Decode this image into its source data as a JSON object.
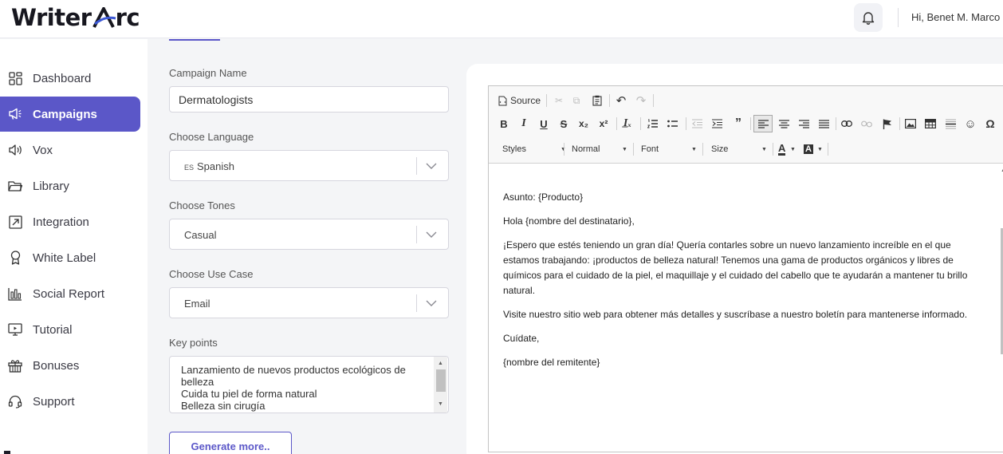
{
  "header": {
    "logo_prefix": "Writer",
    "logo_suffix": "rc",
    "greeting": "Hi, Benet M. Marco"
  },
  "sidebar": {
    "items": [
      {
        "label": "Dashboard",
        "icon": "dashboard-icon"
      },
      {
        "label": "Campaigns",
        "icon": "megaphone-icon",
        "active": true
      },
      {
        "label": "Vox",
        "icon": "speaker-icon"
      },
      {
        "label": "Library",
        "icon": "folder-icon"
      },
      {
        "label": "Integration",
        "icon": "integration-arrow-icon"
      },
      {
        "label": "White Label",
        "icon": "award-icon"
      },
      {
        "label": "Social Report",
        "icon": "bar-chart-icon"
      },
      {
        "label": "Tutorial",
        "icon": "monitor-icon"
      },
      {
        "label": "Bonuses",
        "icon": "gift-icon"
      },
      {
        "label": "Support",
        "icon": "headset-icon"
      }
    ]
  },
  "form": {
    "campaign_name_label": "Campaign Name",
    "campaign_name_value": "Dermatologists",
    "language_label": "Choose Language",
    "language_flag": "ES",
    "language_value": "Spanish",
    "tones_label": "Choose Tones",
    "tones_value": "Casual",
    "use_case_label": "Choose Use Case",
    "use_case_value": "Email",
    "key_points_label": "Key points",
    "key_points": [
      "Lanzamiento de nuevos productos ecológicos de belleza",
      "Cuida tu piel de forma natural",
      "Belleza sin cirugía"
    ],
    "generate_button": "Generate more.."
  },
  "editor": {
    "source_label": "Source",
    "styles_label": "Styles",
    "format_label": "Normal",
    "font_label": "Font",
    "size_label": "Size",
    "text_color_label": "A",
    "bg_color_label": "A",
    "content": [
      "Asunto: {Producto}",
      "Hola {nombre del destinatario},",
      "¡Espero que estés teniendo un gran día! Quería contarles sobre un nuevo lanzamiento increíble en el que estamos trabajando: ¡productos de belleza natural! Tenemos una gama de productos orgánicos y libres de químicos para el cuidado de la piel, el maquillaje y el cuidado del cabello que te ayudarán a mantener tu brillo natural.",
      "Visite nuestro sitio web para obtener más detalles y suscríbase a nuestro boletín para mantenerse informado.",
      "Cuídate,",
      "{nombre del remitente}"
    ]
  },
  "colors": {
    "accent": "#5b57c8",
    "page_bg": "#f4f5f7"
  }
}
